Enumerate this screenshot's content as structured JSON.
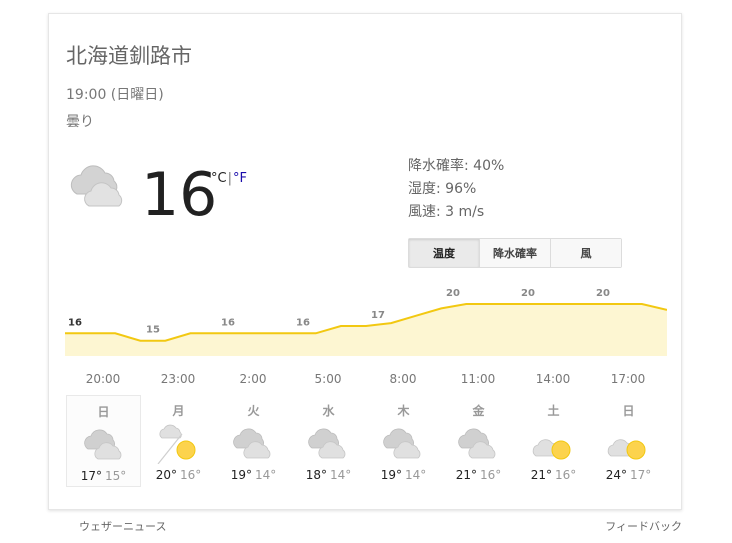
{
  "location": "北海道釧路市",
  "datetime": "19:00 (日曜日)",
  "condition": "曇り",
  "current": {
    "temperature": "16",
    "unit_c": "°C",
    "separator": "|",
    "unit_f": "°F",
    "icon": "cloudy-icon"
  },
  "details": {
    "precipitation": "降水確率: 40%",
    "humidity": "湿度: 96%",
    "wind": "風速: 3 m/s"
  },
  "tabs": [
    {
      "label": "温度",
      "active": true
    },
    {
      "label": "降水確率",
      "active": false
    },
    {
      "label": "風",
      "active": false
    }
  ],
  "hourly": {
    "labels": [
      "20:00",
      "23:00",
      "2:00",
      "5:00",
      "8:00",
      "11:00",
      "14:00",
      "17:00"
    ],
    "temp_labels": [
      "16",
      "15",
      "16",
      "16",
      "17",
      "20",
      "20",
      "20"
    ],
    "temps_series": [
      16,
      16,
      16,
      15,
      15,
      16,
      16,
      16,
      16,
      16,
      16,
      17,
      17,
      17.4,
      18.4,
      19.4,
      20,
      20,
      20,
      20,
      20,
      20,
      20,
      20,
      19.2
    ],
    "line_color": "#f2c811",
    "fill_color": "#fdf6d2"
  },
  "days": [
    {
      "name": "日",
      "icon": "cloudy-icon",
      "high": "17°",
      "low": "15°",
      "selected": true
    },
    {
      "name": "月",
      "icon": "partly-cloudy-icon",
      "high": "20°",
      "low": "16°",
      "selected": false
    },
    {
      "name": "火",
      "icon": "cloudy-icon",
      "high": "19°",
      "low": "14°",
      "selected": false
    },
    {
      "name": "水",
      "icon": "cloudy-icon",
      "high": "18°",
      "low": "14°",
      "selected": false
    },
    {
      "name": "木",
      "icon": "cloudy-icon",
      "high": "19°",
      "low": "14°",
      "selected": false
    },
    {
      "name": "金",
      "icon": "cloudy-icon",
      "high": "21°",
      "low": "16°",
      "selected": false
    },
    {
      "name": "土",
      "icon": "sun-behind-cloud-icon",
      "high": "21°",
      "low": "16°",
      "selected": false
    },
    {
      "name": "日",
      "icon": "sun-behind-cloud-icon",
      "high": "24°",
      "low": "17°",
      "selected": false
    }
  ],
  "footer": {
    "weather_news": "ウェザーニュース",
    "feedback": "フィードバック"
  }
}
